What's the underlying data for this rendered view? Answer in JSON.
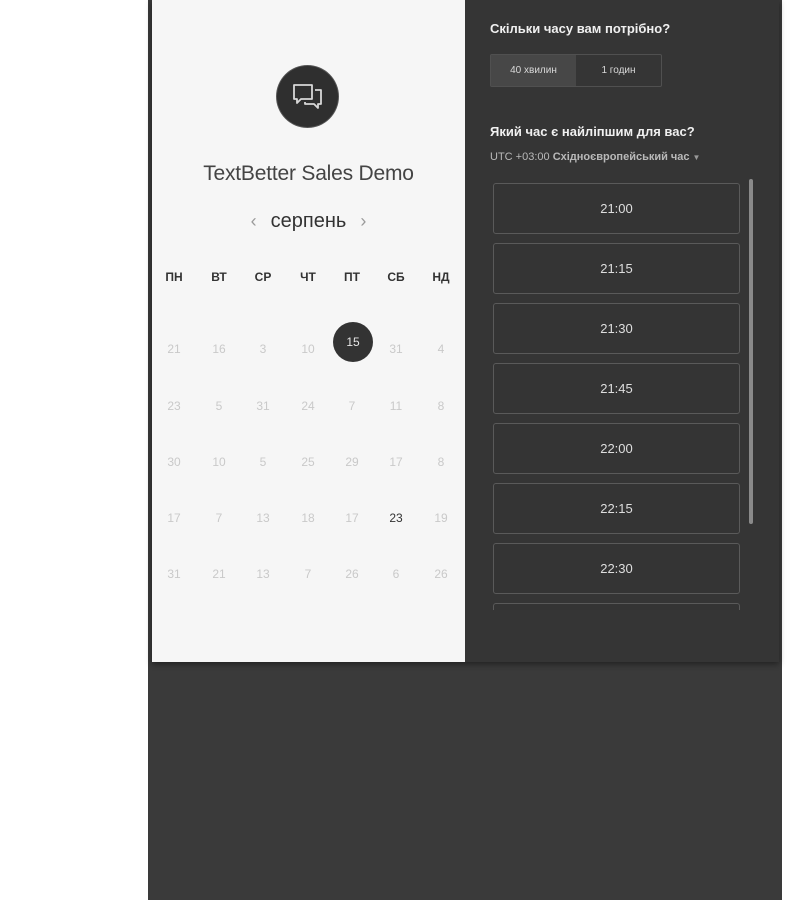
{
  "event": {
    "title": "TextBetter Sales Demo",
    "logo_icon": "chat-bubbles-icon"
  },
  "calendar": {
    "month": "серпень",
    "prev_icon": "chevron-left-icon",
    "next_icon": "chevron-right-icon",
    "weekdays": [
      "ПН",
      "ВТ",
      "СР",
      "ЧТ",
      "ПТ",
      "СБ",
      "НД"
    ],
    "weeks": [
      [
        "21",
        "16",
        "3",
        "10",
        "15",
        "31",
        "4"
      ],
      [
        "23",
        "5",
        "31",
        "24",
        "7",
        "11",
        "8"
      ],
      [
        "30",
        "10",
        "5",
        "25",
        "29",
        "17",
        "8"
      ],
      [
        "17",
        "7",
        "13",
        "18",
        "17",
        "23",
        "19"
      ],
      [
        "31",
        "21",
        "13",
        "7",
        "26",
        "6",
        "26"
      ]
    ],
    "selected_day": "15",
    "available_day": "23"
  },
  "duration": {
    "question": "Скільки часу вам потрібно?",
    "options": [
      "40 хвилин",
      "1 годин"
    ],
    "selected": "40 хвилин"
  },
  "time": {
    "question": "Який час є найліпшим для вас?",
    "tz_offset": "UTC +03:00",
    "tz_name": "Східноєвропейський час",
    "slots": [
      "21:00",
      "21:15",
      "21:30",
      "21:45",
      "22:00",
      "22:15",
      "22:30",
      ""
    ]
  },
  "colors": {
    "accent_dark": "#333333",
    "panel_dark": "#353535",
    "panel_light": "#f6f6f6"
  }
}
